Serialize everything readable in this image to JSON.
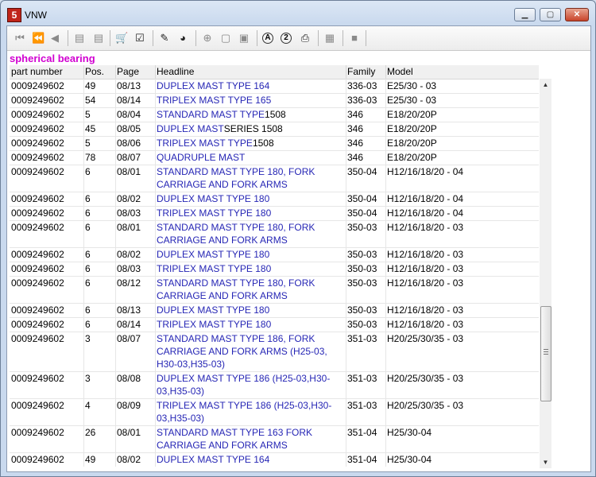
{
  "window": {
    "title": "VNW",
    "app_icon": "5"
  },
  "section_title": "spherical bearing",
  "columns": [
    "part number",
    "Pos.",
    "Page",
    "Headline",
    "Family",
    "Model"
  ],
  "rows": [
    {
      "part": "0009249602",
      "pos": "49",
      "page": "08/13",
      "headline": [
        {
          "t": "DUPLEX MAST TYPE 164",
          "c": "blue"
        }
      ],
      "family": "336-03",
      "model": "E25/30 - 03"
    },
    {
      "part": "0009249602",
      "pos": "54",
      "page": "08/14",
      "headline": [
        {
          "t": "TRIPLEX MAST TYPE 165",
          "c": "blue"
        }
      ],
      "family": "336-03",
      "model": "E25/30 - 03"
    },
    {
      "part": "0009249602",
      "pos": "5",
      "page": "08/04",
      "headline": [
        {
          "t": "STANDARD MAST TYPE",
          "c": "blue"
        },
        {
          "t": "1508",
          "c": "blk"
        }
      ],
      "family": "346",
      "model": "E18/20/20P"
    },
    {
      "part": "0009249602",
      "pos": "45",
      "page": "08/05",
      "headline": [
        {
          "t": "DUPLEX MAST",
          "c": "blue"
        },
        {
          "t": "SERIES 1508",
          "c": "blk"
        }
      ],
      "family": "346",
      "model": "E18/20/20P"
    },
    {
      "part": "0009249602",
      "pos": "5",
      "page": "08/06",
      "headline": [
        {
          "t": "TRIPLEX MAST TYPE",
          "c": "blue"
        },
        {
          "t": "1508",
          "c": "blk"
        }
      ],
      "family": "346",
      "model": "E18/20/20P"
    },
    {
      "part": "0009249602",
      "pos": "78",
      "page": "08/07",
      "headline": [
        {
          "t": "QUADRUPLE MAST",
          "c": "blue"
        }
      ],
      "family": "346",
      "model": "E18/20/20P"
    },
    {
      "part": "0009249602",
      "pos": "6",
      "page": "08/01",
      "headline": [
        {
          "t": "STANDARD MAST TYPE 180, FORK CARRIAGE AND FORK ARMS",
          "c": "blue"
        }
      ],
      "family": "350-04",
      "model": "H12/16/18/20 - 04"
    },
    {
      "part": "0009249602",
      "pos": "6",
      "page": "08/02",
      "headline": [
        {
          "t": "DUPLEX MAST TYPE 180",
          "c": "blue"
        }
      ],
      "family": "350-04",
      "model": "H12/16/18/20 - 04"
    },
    {
      "part": "0009249602",
      "pos": "6",
      "page": "08/03",
      "headline": [
        {
          "t": "TRIPLEX MAST TYPE 180",
          "c": "blue"
        }
      ],
      "family": "350-04",
      "model": "H12/16/18/20 - 04"
    },
    {
      "part": "0009249602",
      "pos": "6",
      "page": "08/01",
      "headline": [
        {
          "t": "STANDARD MAST TYPE 180, FORK CARRIAGE AND FORK ARMS",
          "c": "blue"
        }
      ],
      "family": "350-03",
      "model": "H12/16/18/20 - 03"
    },
    {
      "part": "0009249602",
      "pos": "6",
      "page": "08/02",
      "headline": [
        {
          "t": "DUPLEX MAST TYPE 180",
          "c": "blue"
        }
      ],
      "family": "350-03",
      "model": "H12/16/18/20 - 03"
    },
    {
      "part": "0009249602",
      "pos": "6",
      "page": "08/03",
      "headline": [
        {
          "t": "TRIPLEX MAST TYPE 180",
          "c": "blue"
        }
      ],
      "family": "350-03",
      "model": "H12/16/18/20 - 03"
    },
    {
      "part": "0009249602",
      "pos": "6",
      "page": "08/12",
      "headline": [
        {
          "t": "STANDARD MAST TYPE 180, FORK CARRIAGE AND FORK ARMS",
          "c": "blue"
        }
      ],
      "family": "350-03",
      "model": "H12/16/18/20 - 03"
    },
    {
      "part": "0009249602",
      "pos": "6",
      "page": "08/13",
      "headline": [
        {
          "t": "DUPLEX MAST TYPE 180",
          "c": "blue"
        }
      ],
      "family": "350-03",
      "model": "H12/16/18/20 - 03"
    },
    {
      "part": "0009249602",
      "pos": "6",
      "page": "08/14",
      "headline": [
        {
          "t": "TRIPLEX MAST TYPE 180",
          "c": "blue"
        }
      ],
      "family": "350-03",
      "model": "H12/16/18/20 - 03"
    },
    {
      "part": "0009249602",
      "pos": "3",
      "page": "08/07",
      "headline": [
        {
          "t": "STANDARD MAST TYPE 186, FORK CARRIAGE AND FORK ARMS (H25-03, H30-03,H35-03)",
          "c": "blue"
        }
      ],
      "family": "351-03",
      "model": "H20/25/30/35 - 03"
    },
    {
      "part": "0009249602",
      "pos": "3",
      "page": "08/08",
      "headline": [
        {
          "t": "DUPLEX MAST TYPE 186 (H25-03,H30-03,H35-03)",
          "c": "blue"
        }
      ],
      "family": "351-03",
      "model": "H20/25/30/35 - 03"
    },
    {
      "part": "0009249602",
      "pos": "4",
      "page": "08/09",
      "headline": [
        {
          "t": "TRIPLEX MAST TYPE 186 (H25-03,H30-03,H35-03)",
          "c": "blue"
        }
      ],
      "family": "351-03",
      "model": "H20/25/30/35 - 03"
    },
    {
      "part": "0009249602",
      "pos": "26",
      "page": "08/01",
      "headline": [
        {
          "t": "STANDARD MAST TYPE 163 FORK CARRIAGE AND FORK ARMS",
          "c": "blue"
        }
      ],
      "family": "351-04",
      "model": "H25/30-04"
    },
    {
      "part": "0009249602",
      "pos": "49",
      "page": "08/02",
      "headline": [
        {
          "t": "DUPLEX MAST TYPE 164",
          "c": "blue"
        }
      ],
      "family": "351-04",
      "model": "H25/30-04"
    }
  ],
  "toolbar": [
    {
      "icon": "first-page-icon",
      "glyph": "⏮"
    },
    {
      "icon": "rewind-icon",
      "glyph": "⏪"
    },
    {
      "icon": "previous-icon",
      "glyph": "◀"
    },
    {
      "icon": "page-back-icon",
      "glyph": "▤"
    },
    {
      "icon": "page-forward-icon",
      "glyph": "▤"
    },
    {
      "icon": "cart-icon",
      "glyph": "🛒"
    },
    {
      "icon": "checklist-icon",
      "glyph": "☑"
    },
    {
      "icon": "pencil-icon",
      "glyph": "✎"
    },
    {
      "icon": "pie-chart-icon",
      "glyph": "◕"
    },
    {
      "icon": "zoom-in-icon",
      "glyph": "⊕"
    },
    {
      "icon": "fit-page-icon",
      "glyph": "▢"
    },
    {
      "icon": "fit-width-icon",
      "glyph": "▣"
    },
    {
      "icon": "circled-a-icon",
      "glyph": "A"
    },
    {
      "icon": "circled-2-icon",
      "glyph": "2"
    },
    {
      "icon": "printer-icon",
      "glyph": "⎙"
    },
    {
      "icon": "stack-icon",
      "glyph": "▦"
    },
    {
      "icon": "stop-icon",
      "glyph": "■"
    }
  ]
}
